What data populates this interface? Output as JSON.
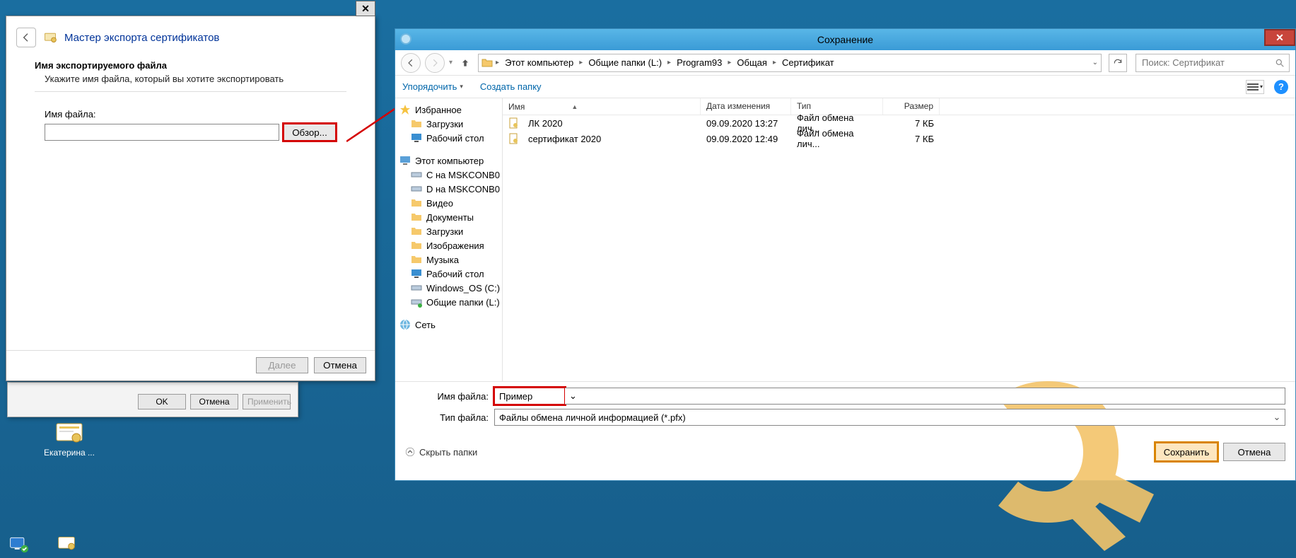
{
  "wizard": {
    "title": "Мастер экспорта сертификатов",
    "heading": "Имя экспортируемого файла",
    "subheading": "Укажите имя файла, который вы хотите экспортировать",
    "filename_label": "Имя файла:",
    "filename_value": "",
    "browse_label": "Обзор...",
    "next_label": "Далее",
    "cancel_label": "Отмена",
    "close_glyph": "✕"
  },
  "child_dialog": {
    "ok": "OK",
    "cancel": "Отмена",
    "apply": "Применить"
  },
  "desktop_icon_label": "Екатерина ...",
  "save_dialog": {
    "title": "Сохранение",
    "close_glyph": "✕",
    "breadcrumbs": [
      "Этот компьютер",
      "Общие папки (L:)",
      "Program93",
      "Общая",
      "Сертификат"
    ],
    "search_placeholder": "Поиск: Сертификат",
    "toolbar": {
      "organize": "Упорядочить",
      "new_folder": "Создать папку"
    },
    "tree": {
      "favorites": {
        "label": "Избранное",
        "items": [
          "Загрузки",
          "Рабочий стол"
        ]
      },
      "this_pc": {
        "label": "Этот компьютер",
        "items": [
          "C на MSKCONB0...",
          "D на MSKCONB0...",
          "Видео",
          "Документы",
          "Загрузки",
          "Изображения",
          "Музыка",
          "Рабочий стол",
          "Windows_OS (C:)",
          "Общие папки (L:)"
        ]
      },
      "network": {
        "label": "Сеть"
      }
    },
    "columns": {
      "name": "Имя",
      "date": "Дата изменения",
      "type": "Тип",
      "size": "Размер"
    },
    "items": [
      {
        "name": "ЛК 2020",
        "date": "09.09.2020 13:27",
        "type": "Файл обмена лич...",
        "size": "7 КБ"
      },
      {
        "name": "сертификат 2020",
        "date": "09.09.2020 12:49",
        "type": "Файл обмена лич...",
        "size": "7 КБ"
      }
    ],
    "filename_label": "Имя файла:",
    "filename_value": "Пример",
    "filetype_label": "Тип файла:",
    "filetype_value": "Файлы обмена личной информацией (*.pfx)",
    "hide_folders": "Скрыть папки",
    "save_label": "Сохранить",
    "cancel_label": "Отмена"
  }
}
